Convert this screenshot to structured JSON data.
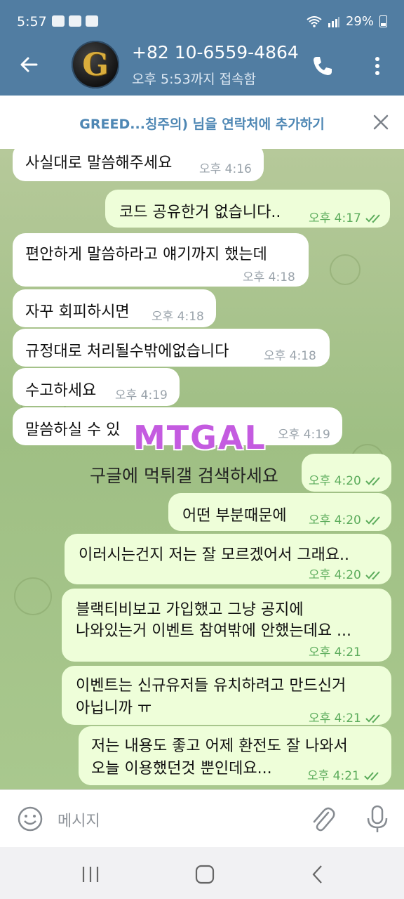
{
  "status": {
    "time": "5:57",
    "battery": "29%"
  },
  "header": {
    "contact": "+82 10-6559-4864",
    "last_seen": "오후 5:53까지 접속함",
    "avatar_letter": "G"
  },
  "banner": {
    "text": "GREED...칭주의) 님을 연락처에 추가하기"
  },
  "messages": [
    {
      "dir": "in",
      "text": "사실대로 말씀해주세요",
      "time": "오후 4:16"
    },
    {
      "dir": "out",
      "text": "코드 공유한거 없습니다..",
      "time": "오후 4:17"
    },
    {
      "dir": "in",
      "text": "편안하게 말씀하라고 얘기까지 했는데",
      "time": "오후 4:18"
    },
    {
      "dir": "in",
      "text": "자꾸 회피하시면",
      "time": "오후 4:18"
    },
    {
      "dir": "in",
      "text": "규정대로 처리될수밖에없습니다",
      "time": "오후 4:18"
    },
    {
      "dir": "in",
      "text": "수고하세요",
      "time": "오후 4:19"
    },
    {
      "dir": "in",
      "text": "말씀하실 수 있",
      "time": "오후 4:19"
    },
    {
      "dir": "out",
      "text": "",
      "time": "오후 4:20"
    },
    {
      "dir": "out",
      "text": "어떤 부분때문에",
      "time": "오후 4:20"
    },
    {
      "dir": "out",
      "text": "이러시는건지 저는 잘 모르겠어서 그래요..",
      "time": "오후 4:20"
    },
    {
      "dir": "out",
      "line1": "블랙티비보고 가입했고 그냥 공지에",
      "line2": "나와있는거 이벤트 참여밖에 안했는데요 ...",
      "time": "오후 4:21"
    },
    {
      "dir": "out",
      "line1": "이벤트는 신규유저들 유치하려고 만드신거",
      "line2": "아닙니까 ㅠ",
      "time": "오후 4:21"
    },
    {
      "dir": "out",
      "line1": "저는 내용도 좋고 어제 환전도 잘 나와서",
      "line2": "오늘 이용했던것 뿐인데요...",
      "time": "오후 4:21"
    }
  ],
  "watermark": {
    "logo": "MTGAL",
    "caption": "구글에 먹튀갤 검색하세요"
  },
  "input": {
    "placeholder": "메시지"
  },
  "colors": {
    "header": "#517da2",
    "outgoing_bubble": "#eefed9",
    "incoming_bubble": "#ffffff",
    "read_ticks": "#5cac5c"
  }
}
